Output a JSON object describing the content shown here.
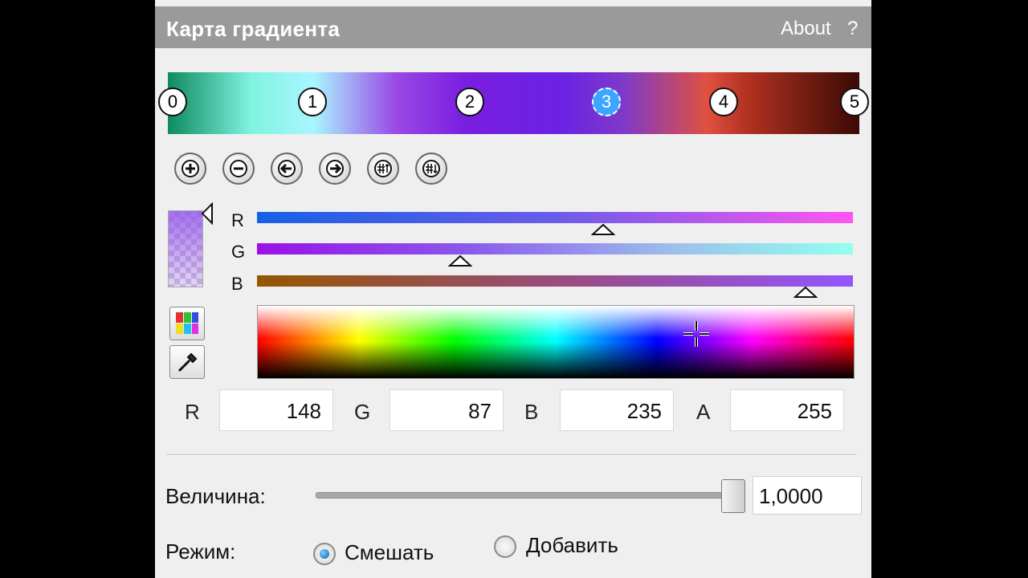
{
  "header": {
    "title": "Карта градиента",
    "about": "About",
    "help": "?"
  },
  "gradient": {
    "colors": [
      "#0f8a5f",
      "#7ff3e0",
      "#a9f6ff",
      "#9a48e6",
      "#7a1ee0",
      "#6b22e4",
      "#7e3ac8",
      "#e05040",
      "#b03020",
      "#3a0a04"
    ],
    "stops": [
      {
        "label": "0"
      },
      {
        "label": "1"
      },
      {
        "label": "2"
      },
      {
        "label": "3",
        "active": true
      },
      {
        "label": "4"
      },
      {
        "label": "5"
      }
    ]
  },
  "toolbar": {
    "buttons": [
      "add-stop",
      "remove-stop",
      "move-left",
      "move-right",
      "distribute-up",
      "distribute-down"
    ]
  },
  "channels": {
    "r_label": "R",
    "g_label": "G",
    "b_label": "B"
  },
  "values": {
    "r_label": "R",
    "r": "148",
    "g_label": "G",
    "g": "87",
    "b_label": "B",
    "b": "235",
    "a_label": "A",
    "a": "255"
  },
  "amount": {
    "label": "Величина:",
    "value": "1,0000",
    "fraction": 1.0
  },
  "mode": {
    "label": "Режим:",
    "options": [
      {
        "label": "Смешать",
        "checked": true
      },
      {
        "label": "Добавить",
        "checked": false
      }
    ]
  },
  "colors": {
    "accent": "#3da5ff",
    "titlebar": "#9a9a9a",
    "selected_color": "#9457eb"
  }
}
